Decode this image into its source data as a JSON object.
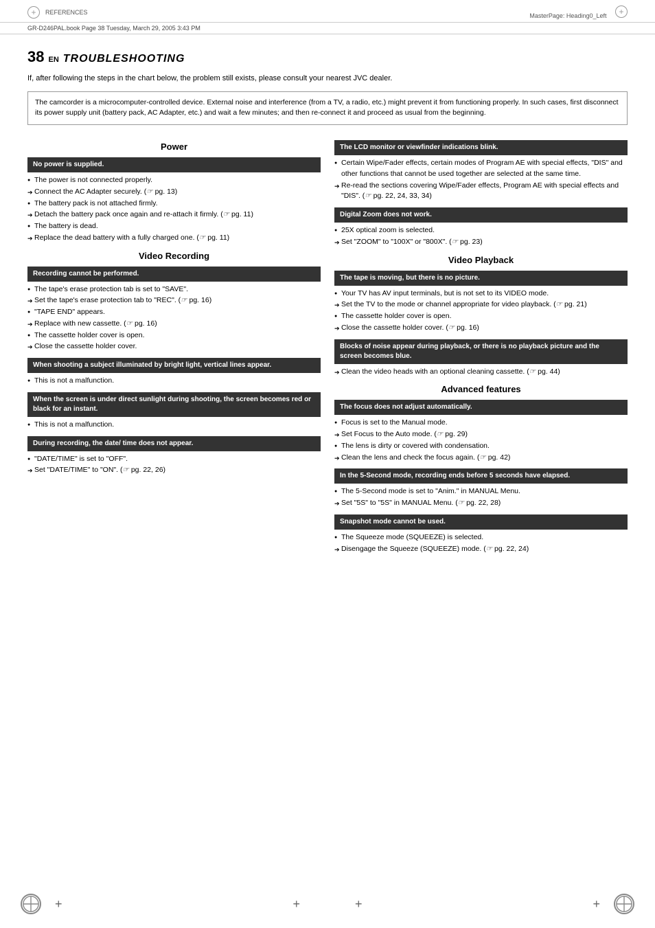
{
  "page": {
    "top_bar": {
      "left_text": "REFERENCES",
      "right_text": "MasterPage: Heading0_Left"
    },
    "subtitle": "GR-D246PAL.book  Page 38  Tuesday, March 29, 2005  3:43 PM",
    "page_number": "38",
    "page_en": "EN",
    "page_title": "TROUBLESHOOTING",
    "intro": "If, after following the steps in the chart below, the problem still exists, please consult your nearest JVC dealer.",
    "warning_box": "The camcorder is a microcomputer-controlled device. External noise and interference (from a TV, a radio, etc.) might prevent it from functioning properly. In such cases, first disconnect its power supply unit (battery pack, AC Adapter, etc.) and wait a few minutes; and then re-connect it and proceed as usual from the beginning.",
    "power_section": {
      "header": "Power",
      "no_power_header": "No power is supplied.",
      "no_power_items": [
        {
          "type": "bullet",
          "text": "The power is not connected properly."
        },
        {
          "type": "arrow",
          "text": "Connect the AC Adapter securely. (☞ pg. 13)"
        },
        {
          "type": "bullet",
          "text": "The battery pack is not attached firmly."
        },
        {
          "type": "arrow",
          "text": "Detach the battery pack once again and re-attach it firmly. (☞ pg. 11)"
        },
        {
          "type": "bullet",
          "text": "The battery is dead."
        },
        {
          "type": "arrow",
          "text": "Replace the dead battery with a fully charged one. (☞ pg. 11)"
        }
      ]
    },
    "video_recording_section": {
      "header": "Video Recording",
      "recording_cannot_header": "Recording cannot be performed.",
      "recording_cannot_items": [
        {
          "type": "bullet",
          "text": "The tape's erase protection tab is set to \"SAVE\"."
        },
        {
          "type": "arrow",
          "text": "Set the tape's erase protection tab to \"REC\". (☞ pg. 16)"
        },
        {
          "type": "bullet",
          "text": "\"TAPE END\" appears."
        },
        {
          "type": "arrow",
          "text": "Replace with new cassette. (☞ pg. 16)"
        },
        {
          "type": "bullet",
          "text": "The cassette holder cover is open."
        },
        {
          "type": "arrow",
          "text": "Close the cassette holder cover."
        }
      ],
      "bright_light_header": "When shooting a subject illuminated by bright light, vertical lines appear.",
      "bright_light_items": [
        {
          "type": "bullet",
          "text": "This is not a malfunction."
        }
      ],
      "direct_sunlight_header": "When the screen is under direct sunlight during shooting, the screen becomes red or black for an instant.",
      "direct_sunlight_items": [
        {
          "type": "bullet",
          "text": "This is not a malfunction."
        }
      ],
      "date_time_header": "During recording, the date/ time does not appear.",
      "date_time_items": [
        {
          "type": "bullet",
          "text": "\"DATE/TIME\" is set to \"OFF\"."
        },
        {
          "type": "arrow",
          "text": "Set \"DATE/TIME\" to \"ON\". (☞ pg. 22, 26)"
        }
      ]
    },
    "video_playback_section": {
      "header": "Video Playback",
      "lcd_blink_header": "The LCD monitor or viewfinder indications blink.",
      "lcd_blink_items": [
        {
          "type": "bullet",
          "text": "Certain Wipe/Fader effects, certain modes of Program AE with special effects, \"DIS\" and other functions that cannot be used together are selected at the same time."
        },
        {
          "type": "arrow",
          "text": "Re-read the sections covering Wipe/Fader effects, Program AE with special effects and \"DIS\". (☞ pg. 22, 24, 33, 34)"
        }
      ],
      "digital_zoom_header": "Digital Zoom does not work.",
      "digital_zoom_items": [
        {
          "type": "bullet",
          "text": "25X optical zoom is selected."
        },
        {
          "type": "arrow",
          "text": "Set \"ZOOM\" to \"100X\" or \"800X\". (☞ pg. 23)"
        }
      ],
      "tape_moving_header": "The tape is moving, but there is no picture.",
      "tape_moving_items": [
        {
          "type": "bullet",
          "text": "Your TV has AV input terminals, but is not set to its VIDEO mode."
        },
        {
          "type": "arrow",
          "text": "Set the TV to the mode or channel appropriate for video playback. (☞ pg. 21)"
        },
        {
          "type": "bullet",
          "text": "The cassette holder cover is open."
        },
        {
          "type": "arrow",
          "text": "Close the cassette holder cover. (☞ pg. 16)"
        }
      ],
      "blocks_noise_header": "Blocks of noise appear during playback, or there is no playback picture and the screen becomes blue.",
      "blocks_noise_items": [
        {
          "type": "arrow",
          "text": "Clean the video heads with an optional cleaning cassette. (☞ pg. 44)"
        }
      ]
    },
    "advanced_features_section": {
      "header": "Advanced features",
      "focus_header": "The focus does not adjust automatically.",
      "focus_items": [
        {
          "type": "bullet",
          "text": "Focus is set to the Manual mode."
        },
        {
          "type": "arrow",
          "text": "Set Focus to the Auto mode. (☞ pg. 29)"
        },
        {
          "type": "bullet",
          "text": "The lens is dirty or covered with condensation."
        },
        {
          "type": "arrow",
          "text": "Clean the lens and check the focus again. (☞ pg. 42)"
        }
      ],
      "five_second_header": "In the 5-Second mode, recording ends before 5 seconds have elapsed.",
      "five_second_items": [
        {
          "type": "bullet",
          "text": "The 5-Second mode is set to \"Anim.\" in MANUAL Menu."
        },
        {
          "type": "arrow",
          "text": "Set \"5S\" to \"5S\" in MANUAL Menu. (☞ pg. 22, 28)"
        }
      ],
      "snapshot_header": "Snapshot mode cannot be used.",
      "snapshot_items": [
        {
          "type": "bullet",
          "text": "The Squeeze mode (SQUEEZE) is selected."
        },
        {
          "type": "arrow",
          "text": "Disengage the Squeeze (SQUEEZE) mode. (☞ pg. 22, 24)"
        }
      ]
    }
  }
}
